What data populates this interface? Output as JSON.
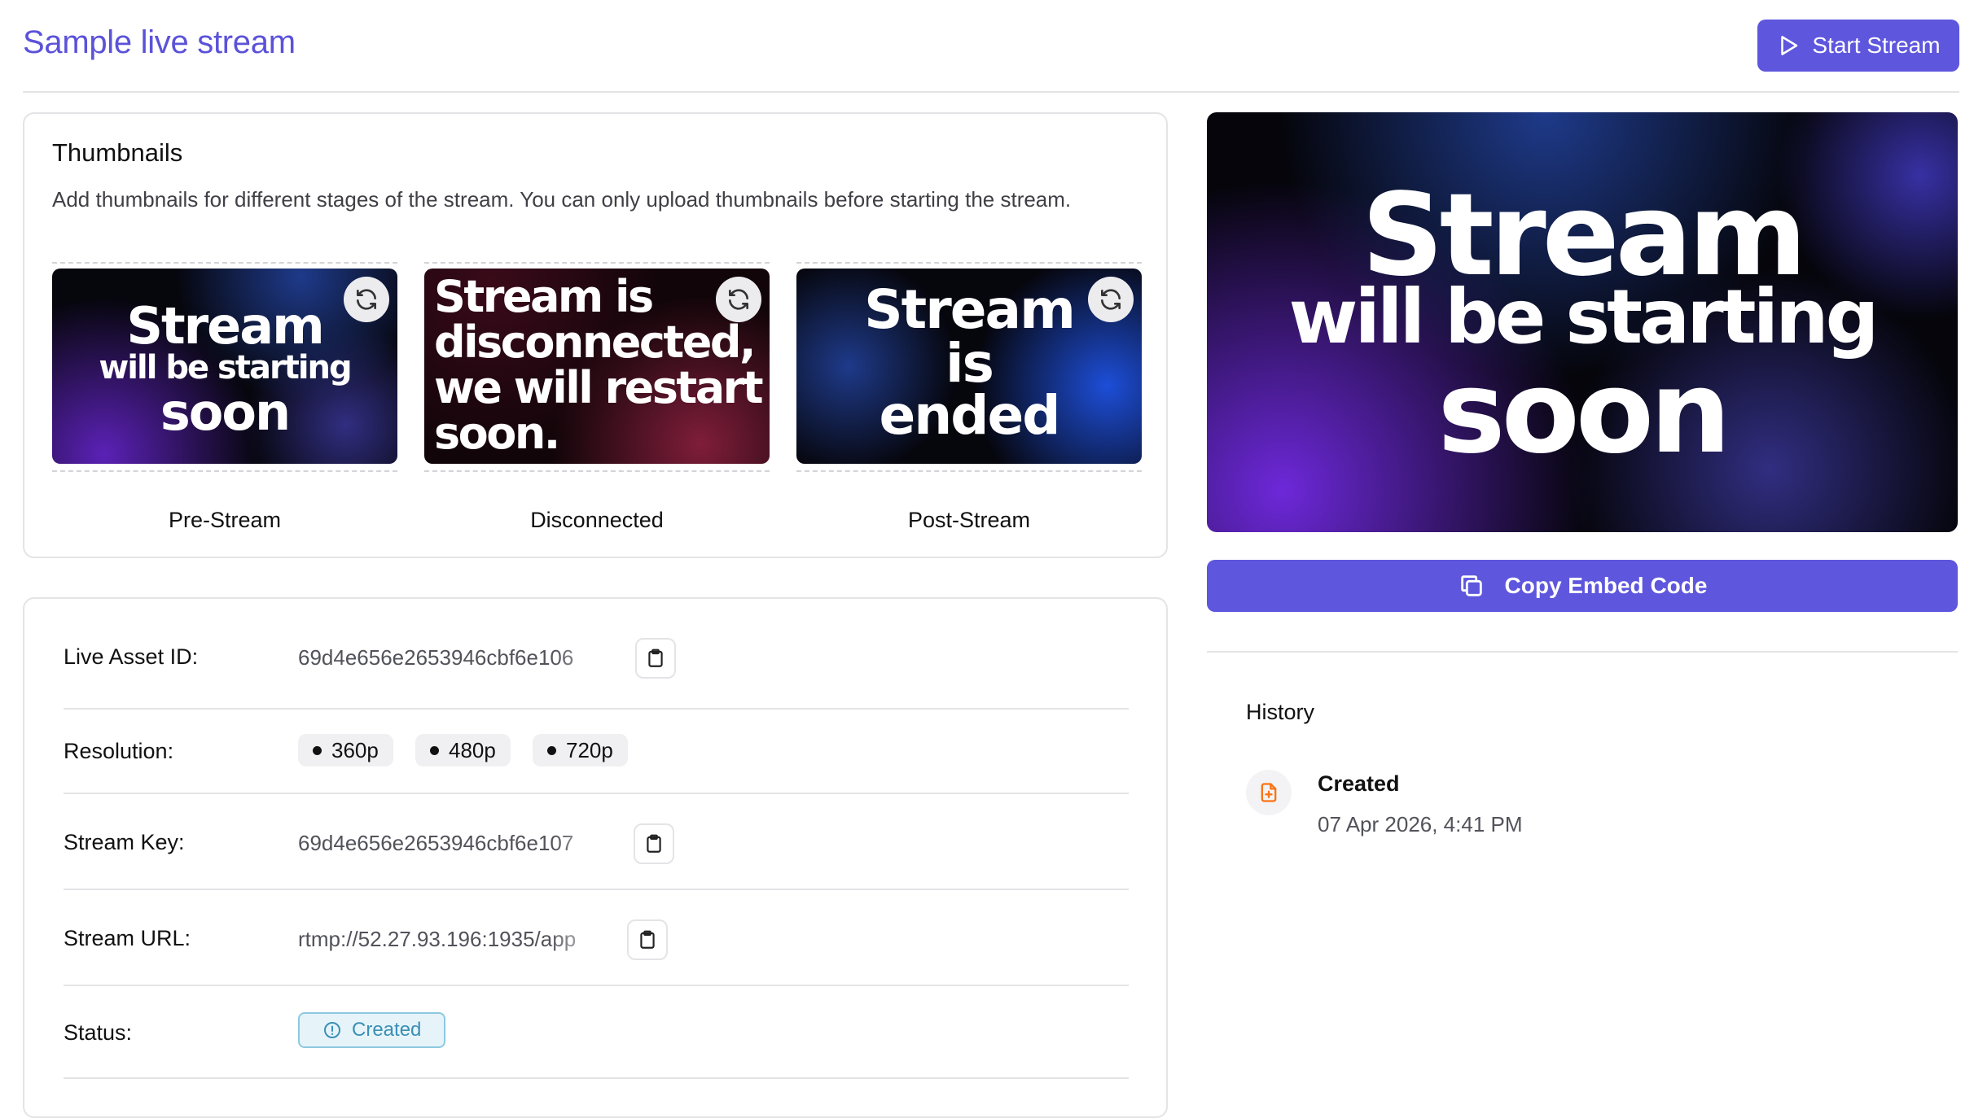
{
  "header": {
    "title": "Sample live stream",
    "start_button": "Start Stream"
  },
  "thumbnails": {
    "title": "Thumbnails",
    "description": "Add thumbnails for different stages of the stream. You can only upload thumbnails before starting the stream.",
    "items": [
      {
        "label": "Pre-Stream",
        "image_lines": [
          "Stream",
          "will be starting",
          "soon"
        ]
      },
      {
        "label": "Disconnected",
        "image_lines": [
          "Stream is",
          "disconnected,",
          "we will restart",
          "soon."
        ]
      },
      {
        "label": "Post-Stream",
        "image_lines": [
          "Stream",
          "is",
          "ended"
        ]
      }
    ]
  },
  "details": {
    "live_asset_id": {
      "label": "Live Asset ID:",
      "value": "69d4e656e2653946cbf6e106"
    },
    "resolution": {
      "label": "Resolution:",
      "values": [
        "360p",
        "480p",
        "720p"
      ]
    },
    "stream_key": {
      "label": "Stream Key:",
      "value": "69d4e656e2653946cbf6e107"
    },
    "stream_url": {
      "label": "Stream URL:",
      "value": "rtmp://52.27.93.196:1935/app"
    },
    "status": {
      "label": "Status:",
      "value": "Created"
    }
  },
  "preview": {
    "image_lines": [
      "Stream",
      "will be starting",
      "soon"
    ]
  },
  "embed": {
    "label": "Copy Embed Code"
  },
  "history": {
    "title": "History",
    "events": [
      {
        "event": "Created",
        "time": "07 Apr 2026, 4:41 PM"
      }
    ]
  },
  "colors": {
    "accent": "#5e56dd",
    "title": "#5b52d9",
    "status_bg": "#e6f4fa",
    "status_border": "#8cc9e0",
    "status_text": "#3a8fb5",
    "history_icon": "#f97316"
  },
  "icons": {
    "start": "play-icon",
    "refresh": "refresh-icon",
    "copy": "clipboard-icon",
    "embed": "copy-icon",
    "status": "info-circle-icon",
    "history": "file-plus-icon"
  }
}
